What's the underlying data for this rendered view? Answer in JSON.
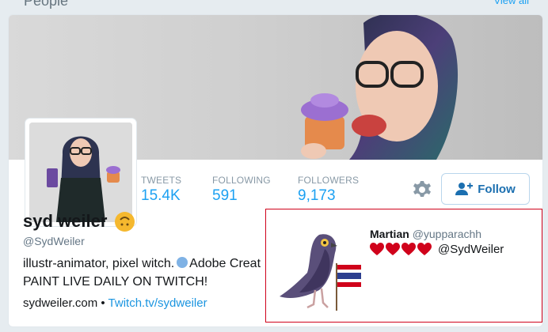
{
  "section": {
    "title": "People",
    "view_all": "View all"
  },
  "profile": {
    "name": "syd weiler",
    "handle": "@SydWeiler",
    "bio_line1_before": "illustr-animator, pixel witch.",
    "bio_line1_after": "Adobe Creat",
    "bio_line2": "PAINT LIVE DAILY ON TWITCH!",
    "website": "sydweiler.com",
    "separator": "•",
    "twitch_link": "Twitch.tv/sydweiler",
    "stats": [
      {
        "label": "TWEETS",
        "value": "15.4K"
      },
      {
        "label": "FOLLOWING",
        "value": "591"
      },
      {
        "label": "FOLLOWERS",
        "value": "9,173"
      }
    ],
    "follow_label": "Follow"
  },
  "reply_card": {
    "name": "Martian",
    "handle": "@yupparachh",
    "mention": "@SydWeiler",
    "heart_count": 4
  },
  "colors": {
    "accent": "#1da1f2",
    "heart": "#d0021b",
    "highlight_border": "#d0021b"
  }
}
